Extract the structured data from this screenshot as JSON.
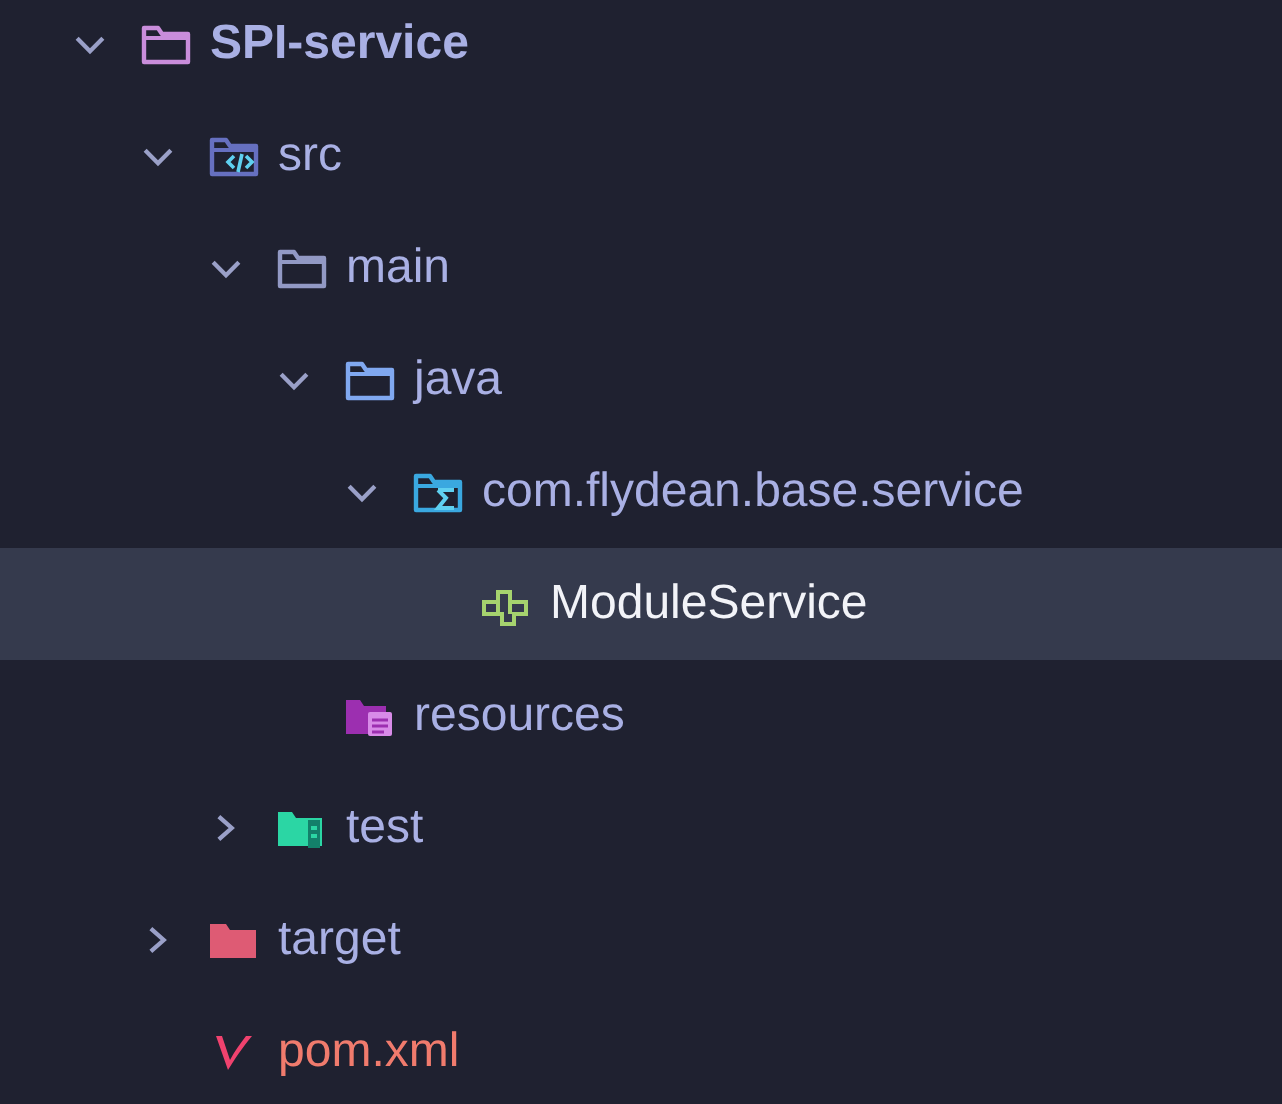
{
  "tree": [
    {
      "label": "SPI-service",
      "kind": "module",
      "expanded": true,
      "selected": false,
      "children": [
        {
          "label": "src",
          "kind": "source",
          "expanded": true,
          "selected": false,
          "children": [
            {
              "label": "main",
              "kind": "folder",
              "expanded": true,
              "selected": false,
              "children": [
                {
                  "label": "java",
                  "kind": "java",
                  "expanded": true,
                  "selected": false,
                  "children": [
                    {
                      "label": "com.flydean.base.service",
                      "kind": "package",
                      "expanded": true,
                      "selected": false,
                      "children": [
                        {
                          "label": "ModuleService",
                          "kind": "interface",
                          "selected": true
                        }
                      ]
                    }
                  ]
                },
                {
                  "label": "resources",
                  "kind": "resources",
                  "selected": false
                }
              ]
            },
            {
              "label": "test",
              "kind": "test",
              "expanded": false,
              "selected": false
            }
          ]
        },
        {
          "label": "target",
          "kind": "target",
          "expanded": false,
          "selected": false
        },
        {
          "label": "pom.xml",
          "kind": "maven",
          "selected": false
        }
      ]
    }
  ]
}
